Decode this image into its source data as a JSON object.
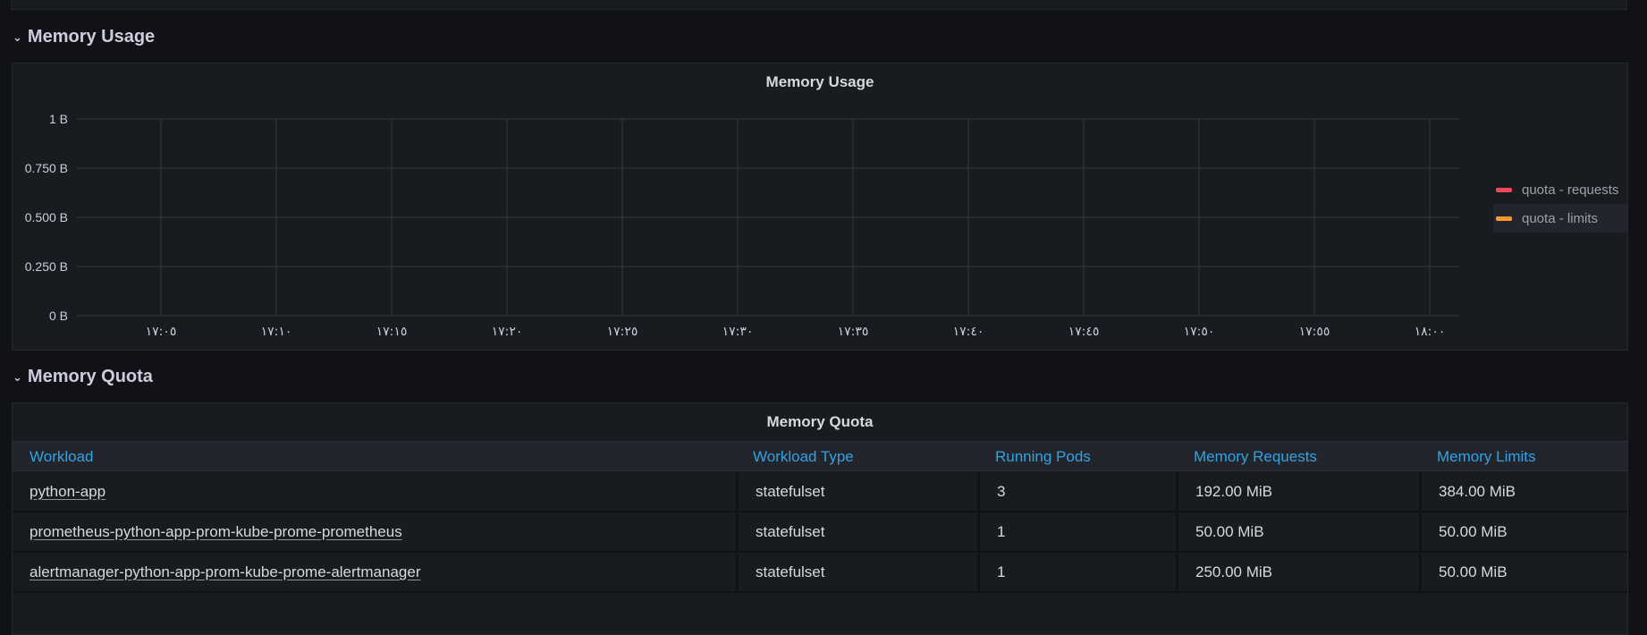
{
  "rows": [
    {
      "title": "Memory Usage"
    },
    {
      "title": "Memory Quota"
    }
  ],
  "chart_panel": {
    "title": "Memory Usage"
  },
  "chart_data": {
    "type": "line",
    "title": "Memory Usage",
    "y_ticks": [
      "0 B",
      "0.250 B",
      "0.500 B",
      "0.750 B",
      "1 B"
    ],
    "ylim": [
      0,
      1
    ],
    "x_ticks": [
      "١٧:٠٥",
      "١٧:١٠",
      "١٧:١٥",
      "١٧:٢٠",
      "١٧:٢٥",
      "١٧:٣٠",
      "١٧:٣٥",
      "١٧:٤٠",
      "١٧:٤٥",
      "١٧:٥٠",
      "١٧:٥٥",
      "١٨:٠٠"
    ],
    "grid": true,
    "legend_position": "right",
    "series": [
      {
        "name": "quota - requests",
        "color": "#f2495c",
        "values": []
      },
      {
        "name": "quota - limits",
        "color": "#ff9830",
        "values": []
      }
    ]
  },
  "table_panel": {
    "title": "Memory Quota",
    "columns": [
      "Workload",
      "Workload Type",
      "Running Pods",
      "Memory Requests",
      "Memory Limits"
    ],
    "rows": [
      [
        "python-app",
        "statefulset",
        "3",
        "192.00 MiB",
        "384.00 MiB"
      ],
      [
        "prometheus-python-app-prom-kube-prome-prometheus",
        "statefulset",
        "1",
        "50.00 MiB",
        "50.00 MiB"
      ],
      [
        "alertmanager-python-app-prom-kube-prome-alertmanager",
        "statefulset",
        "1",
        "250.00 MiB",
        "50.00 MiB"
      ]
    ]
  },
  "colors": {
    "background": "#111217",
    "panel": "#181b1f",
    "header_link": "#33a2e5"
  }
}
